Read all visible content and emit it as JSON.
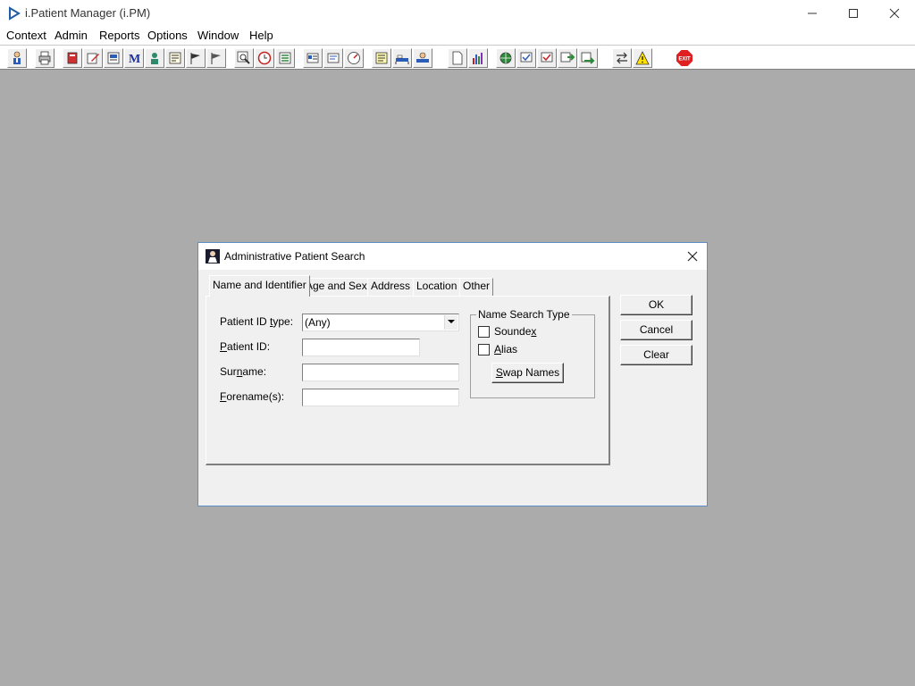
{
  "window": {
    "title": "i.Patient Manager (i.PM)"
  },
  "menu": [
    "Context",
    "Admin",
    "Reports",
    "Options",
    "Window",
    "Help"
  ],
  "toolbar": {
    "icons": [
      "patient-icon",
      "print-icon",
      "book-icon",
      "edit-icon",
      "report-icon",
      "m-icon",
      "doctor-icon",
      "form-icon",
      "flag-icon",
      "flag-icon",
      "search-icon",
      "clock-icon",
      "list-icon",
      "card-icon",
      "note-icon",
      "gauge-icon",
      "memo-icon",
      "bed-icon",
      "transfer-icon",
      "document-icon",
      "chart-icon",
      "globe-icon",
      "check-icon",
      "tick-icon",
      "next-icon",
      "forward-icon",
      "swap-icon",
      "warning-icon",
      "exit-icon"
    ],
    "exit_label": "EXIT"
  },
  "dialog": {
    "title": "Administrative Patient Search",
    "tabs": [
      {
        "label": "Name and Identifier",
        "active": true
      },
      {
        "label": "Age and Sex"
      },
      {
        "label": "Address"
      },
      {
        "label": "Location"
      },
      {
        "label": "Other"
      }
    ],
    "fields": {
      "patient_id_type": {
        "label_pre": "Patient ID ",
        "label_u": "t",
        "label_post": "ype:",
        "value": "(Any)"
      },
      "patient_id": {
        "label_pre": "",
        "label_u": "P",
        "label_post": "atient ID:",
        "value": ""
      },
      "surname": {
        "label_pre": "Sur",
        "label_u": "n",
        "label_post": "ame:",
        "value": ""
      },
      "forenames": {
        "label_pre": "",
        "label_u": "F",
        "label_post": "orename(s):",
        "value": ""
      }
    },
    "name_search": {
      "legend": "Name Search Type",
      "soundex": {
        "pre": "Sounde",
        "u": "x",
        "post": "",
        "checked": false
      },
      "alias": {
        "pre": "",
        "u": "A",
        "post": "lias",
        "checked": false
      },
      "swap": {
        "pre": "",
        "u": "S",
        "post": "wap Names"
      }
    },
    "buttons": {
      "ok": "OK",
      "cancel": "Cancel",
      "clear": "Clear"
    }
  },
  "colors": {
    "desktop": "#ababab",
    "accent": "#0078d7",
    "dialog_border": "#5b8fc6"
  }
}
